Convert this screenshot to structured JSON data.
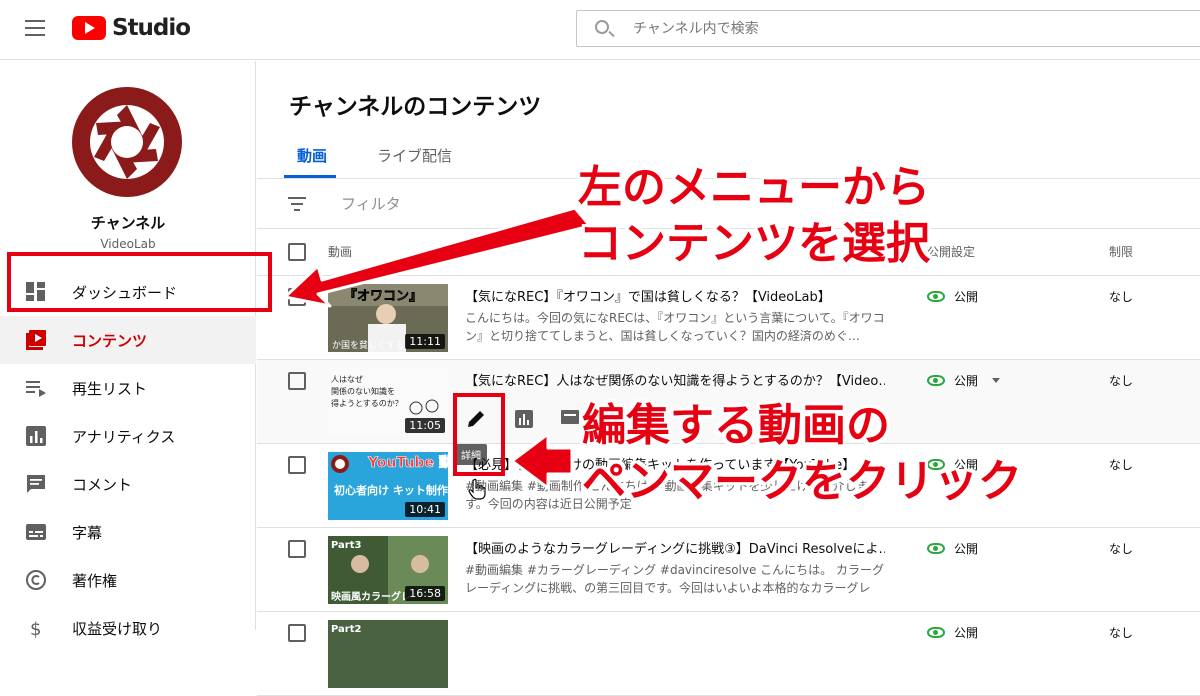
{
  "app": {
    "title": "Studio"
  },
  "search": {
    "placeholder": "チャンネル内で検索"
  },
  "sidebar": {
    "channel_name": "チャンネル",
    "channel_handle": "VideoLab",
    "items": [
      {
        "label": "ダッシュボード",
        "icon": "dashboard-icon",
        "active": false
      },
      {
        "label": "コンテンツ",
        "icon": "content-icon",
        "active": true
      },
      {
        "label": "再生リスト",
        "icon": "playlist-icon",
        "active": false
      },
      {
        "label": "アナリティクス",
        "icon": "analytics-icon",
        "active": false
      },
      {
        "label": "コメント",
        "icon": "comment-icon",
        "active": false
      },
      {
        "label": "字幕",
        "icon": "subtitles-icon",
        "active": false
      },
      {
        "label": "著作権",
        "icon": "copyright-icon",
        "active": false
      },
      {
        "label": "収益受け取り",
        "icon": "dollar-icon",
        "active": false
      }
    ]
  },
  "main": {
    "title": "チャンネルのコンテンツ",
    "tabs": [
      {
        "label": "動画"
      },
      {
        "label": "ライブ配信"
      }
    ],
    "filter_placeholder": "フィルタ",
    "columns": {
      "video": "動画",
      "visibility": "公開設定",
      "restrictions": "制限"
    },
    "tooltip": "詳細",
    "rows": [
      {
        "title": "【気になREC】『オワコン』で国は貧しくなる？【VideoLab】",
        "desc": "こんにちは。今回の気になRECは、『オワコン』という言葉について。『オワコン』と切り捨ててしまうと、国は貧しくなっていく？国内の経済のめぐ…",
        "duration": "11:11",
        "thumb_text": "『オワコン』",
        "thumb_caption": "か国を貧しくする",
        "visibility": "公開",
        "restriction": "なし"
      },
      {
        "title": "【気になREC】人はなぜ関係のない知識を得ようとするのか？【Video…",
        "desc": "",
        "duration": "11:05",
        "thumb_text": "人はなぜ関係のない知識を得ようとするのか？",
        "visibility": "公開",
        "restriction": "なし"
      },
      {
        "title": "【必見】初心者向けの動画編集キットを作っています【YouTube】",
        "desc": "#動画編集 #動画制作 こんにちは。 動画編集キットを少しだけご紹介します。今回の内容は近日公開予定",
        "duration": "10:41",
        "thumb_text": "YouTube 動画編集",
        "thumb_caption": "初心者向け キット制作中",
        "visibility": "公開",
        "restriction": "なし"
      },
      {
        "title": "【映画のようなカラーグレーディングに挑戦③】DaVinci Resolveによ…",
        "desc": "#動画編集 #カラーグレーディング #davinciresolve こんにちは。 カラーグレーディングに挑戦、の第三回目です。今回はいよいよ本格的なカラーグレー…",
        "duration": "16:58",
        "thumb_text": "Part3",
        "thumb_caption": "映画風カラーグレ",
        "visibility": "公開",
        "restriction": "なし"
      },
      {
        "title": "",
        "desc": "",
        "duration": "",
        "thumb_text": "Part2",
        "visibility": "公開",
        "restriction": "なし"
      }
    ]
  },
  "annotations": {
    "callout_1_line_1": "左のメニューから",
    "callout_1_line_2": "コンテンツを選択",
    "callout_2_line_1": "編集する動画の",
    "callout_2_line_2": "ペンマークをクリック"
  },
  "colors": {
    "brand_red": "#ff0000",
    "annotation_red": "#e60012",
    "tab_blue": "#065fd4",
    "public_green": "#2ba640",
    "channel_avatar": "#8b1a1a"
  }
}
